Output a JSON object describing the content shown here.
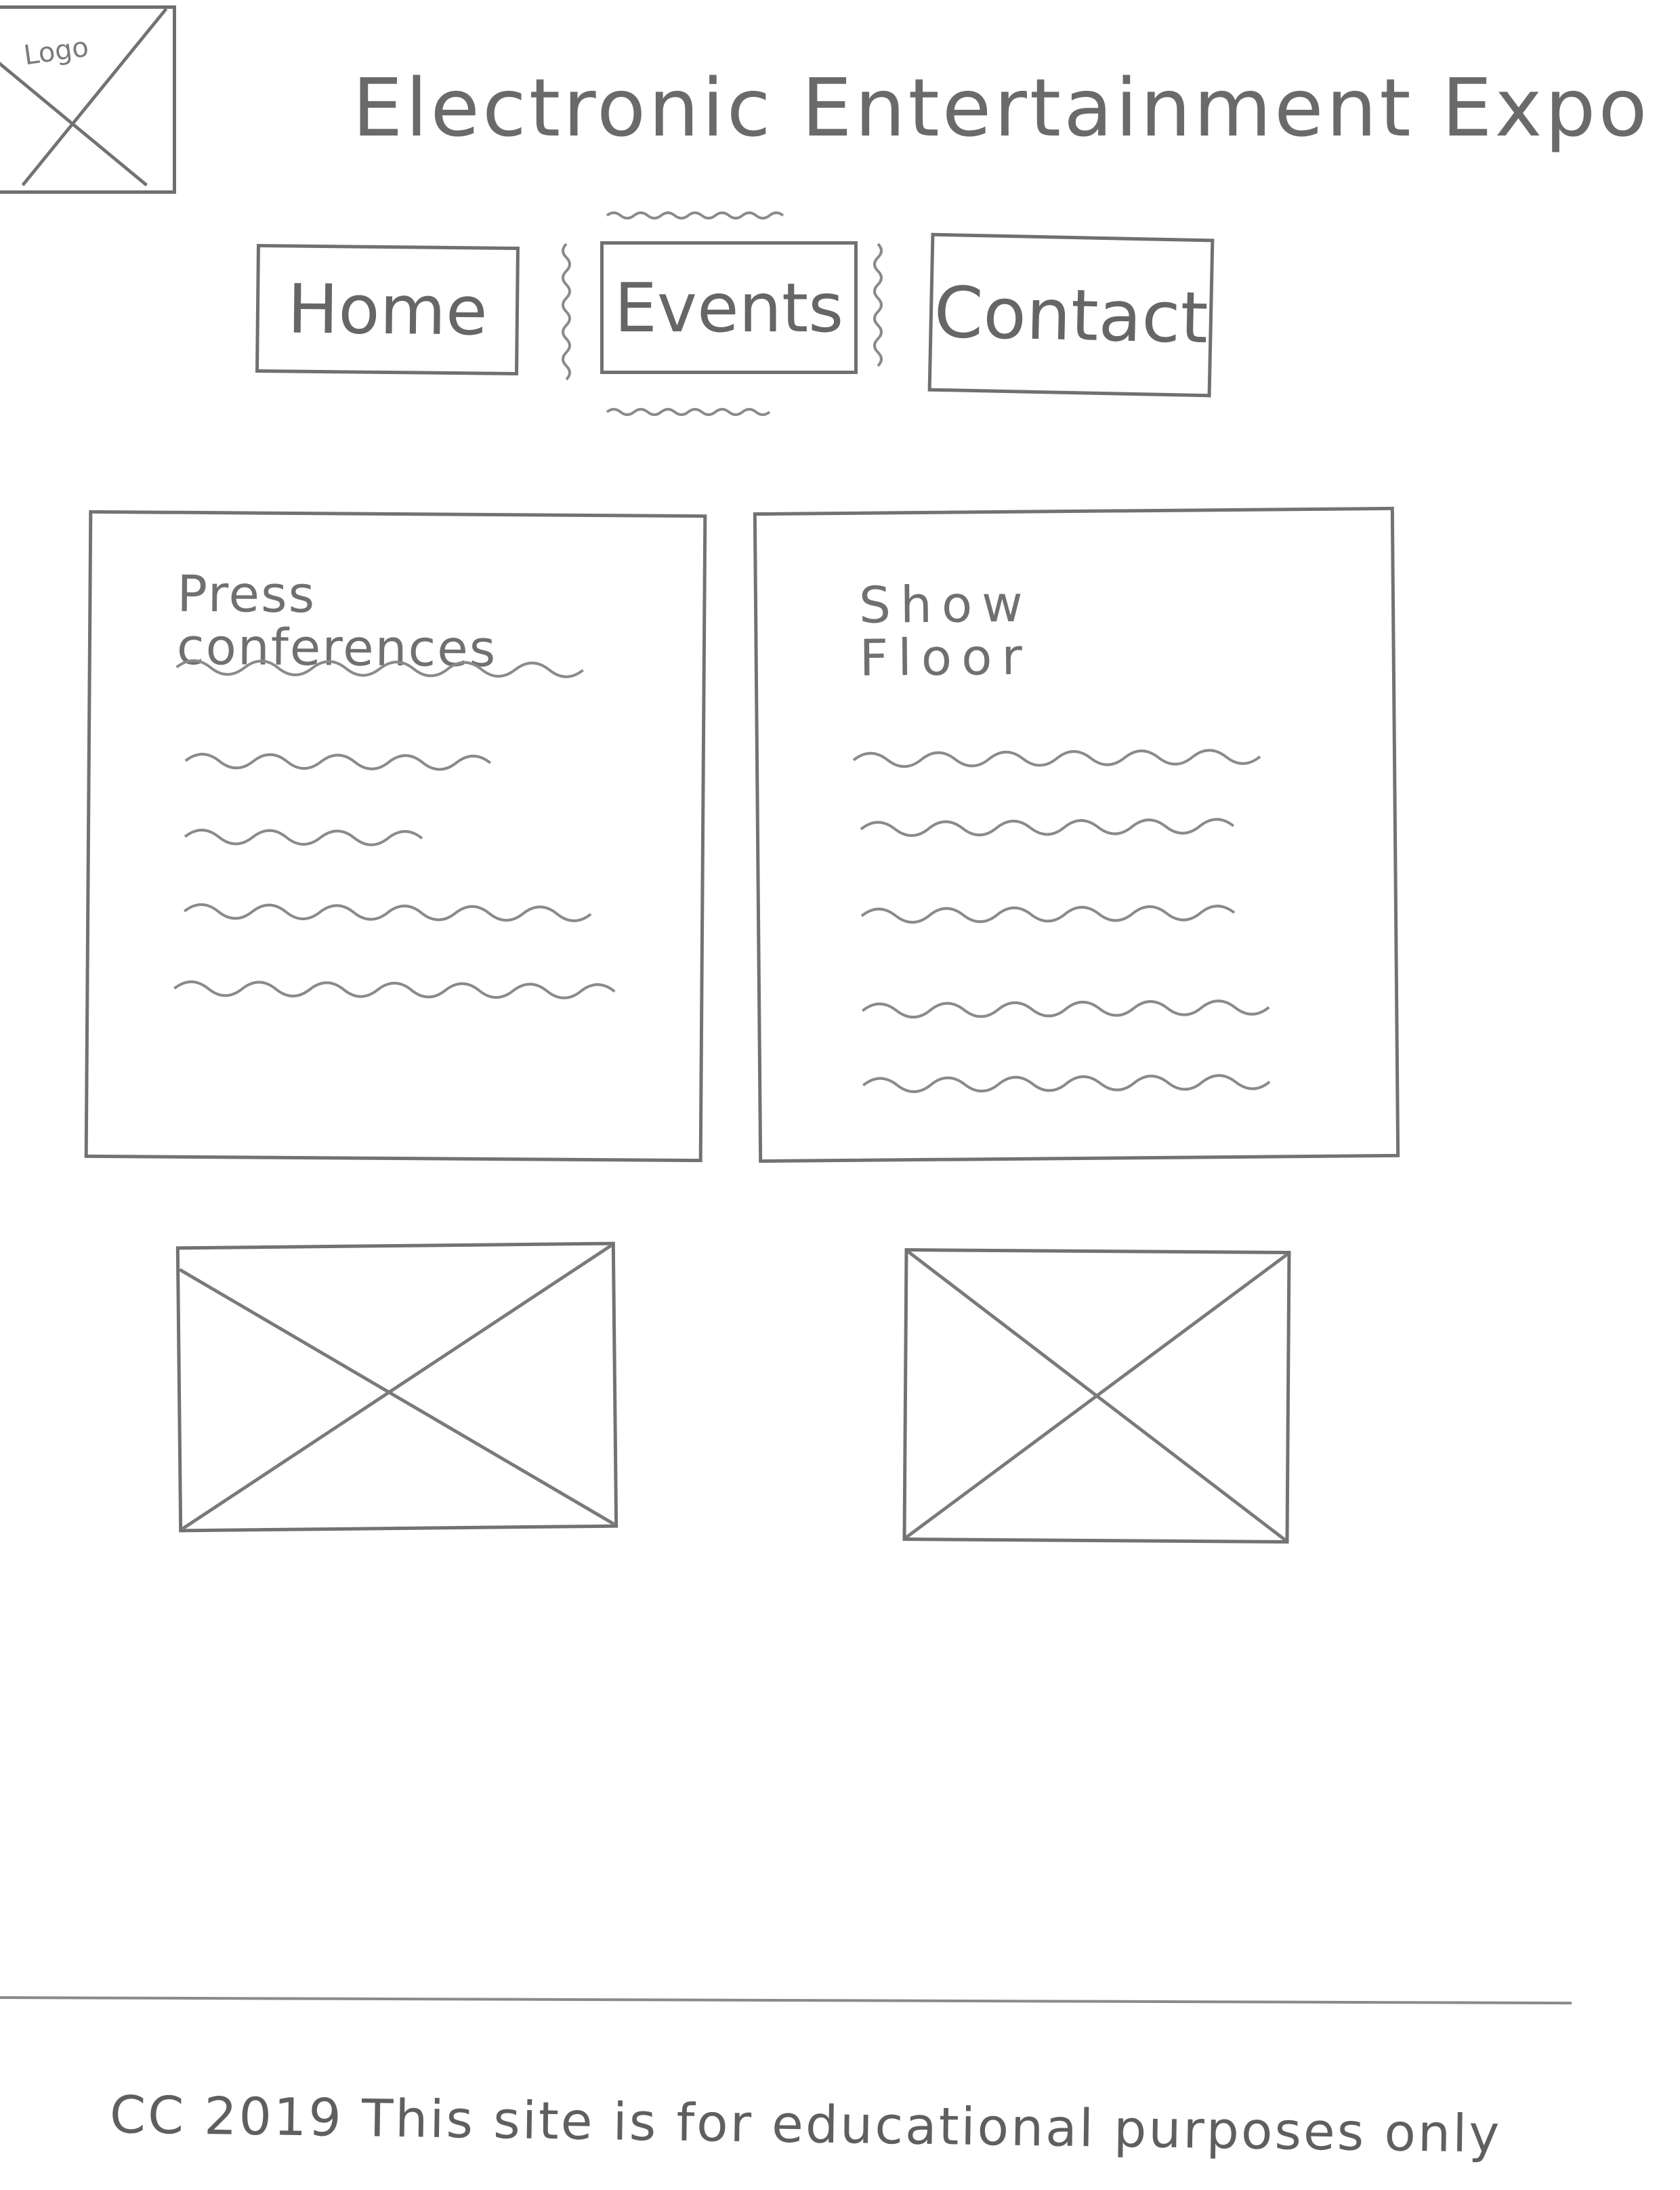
{
  "header": {
    "logo_label": "Logo",
    "site_title": "Electronic Entertainment Expo"
  },
  "nav": {
    "items": [
      {
        "label": "Home",
        "icon": "none"
      },
      {
        "label": "Events",
        "icon": "none"
      },
      {
        "label": "Contact",
        "icon": "none"
      }
    ],
    "active_index": 1
  },
  "cards": [
    {
      "heading_line1": "Press",
      "heading_line2": "conferences",
      "text_lines": 5
    },
    {
      "heading_line1": "Show",
      "heading_line2": "Floor",
      "text_lines": 5
    }
  ],
  "images": [
    {
      "icon": "image-placeholder-icon"
    },
    {
      "icon": "image-placeholder-icon"
    }
  ],
  "footer": {
    "text": "CC 2019 This site is for educational purposes only"
  },
  "colors": {
    "stroke": "#707070",
    "background": "#ffffff"
  }
}
